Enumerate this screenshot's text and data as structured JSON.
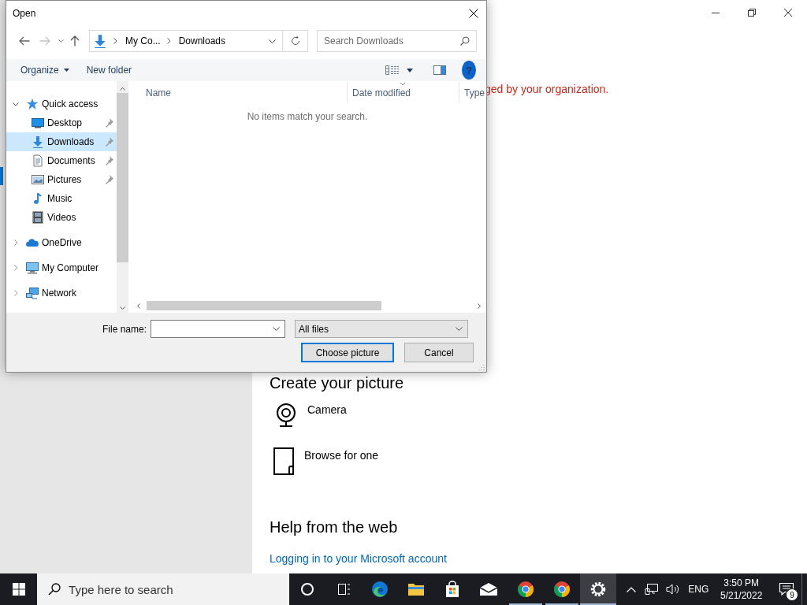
{
  "settings_window": {
    "notice": "ged by your organization.",
    "section_title": "Create your picture",
    "options": [
      {
        "label": "Camera"
      },
      {
        "label": "Browse for one"
      }
    ],
    "help_title": "Help from the web",
    "help_link": "Logging in to your Microsoft account"
  },
  "dialog": {
    "title": "Open",
    "back_disabled": false,
    "forward_disabled": true,
    "address": [
      "My Co...",
      "Downloads"
    ],
    "search": {
      "placeholder": "Search Downloads"
    },
    "toolbar": {
      "organize": "Organize",
      "new_folder": "New folder",
      "help": "?"
    },
    "nav_tree": [
      {
        "label": "Quick access",
        "expanded": true,
        "selected": false,
        "children": [
          {
            "label": "Desktop",
            "pinned": true,
            "selected": false
          },
          {
            "label": "Downloads",
            "pinned": true,
            "selected": true
          },
          {
            "label": "Documents",
            "pinned": true,
            "selected": false
          },
          {
            "label": "Pictures",
            "pinned": true,
            "selected": false
          },
          {
            "label": "Music",
            "pinned": false,
            "selected": false
          },
          {
            "label": "Videos",
            "pinned": false,
            "selected": false
          }
        ]
      },
      {
        "label": "OneDrive",
        "expanded": false,
        "selected": false
      },
      {
        "label": "My Computer",
        "expanded": false,
        "selected": false
      },
      {
        "label": "Network",
        "expanded": false,
        "selected": false
      }
    ],
    "columns": [
      {
        "label": "Name",
        "sorted": false
      },
      {
        "label": "Date modified",
        "sorted": true
      },
      {
        "label": "Type",
        "sorted": false
      }
    ],
    "empty_message": "No items match your search.",
    "file_name_label": "File name:",
    "file_type": "All files",
    "buttons": [
      {
        "label": "Choose picture",
        "default": true
      },
      {
        "label": "Cancel",
        "default": false
      }
    ]
  },
  "taskbar": {
    "search": {
      "placeholder": "Type here to search"
    },
    "apps": [
      {
        "active": false,
        "running": false
      },
      {
        "active": false,
        "running": false
      },
      {
        "active": false,
        "running": false
      },
      {
        "active": false,
        "running": false
      },
      {
        "active": false,
        "running": false
      },
      {
        "active": false,
        "running": false
      },
      {
        "active": false,
        "running": true
      },
      {
        "active": false,
        "running": true
      },
      {
        "active": true,
        "running": true
      }
    ],
    "language": "ENG",
    "time": "3:50 PM",
    "date": "5/21/2022",
    "notifications": "9"
  }
}
